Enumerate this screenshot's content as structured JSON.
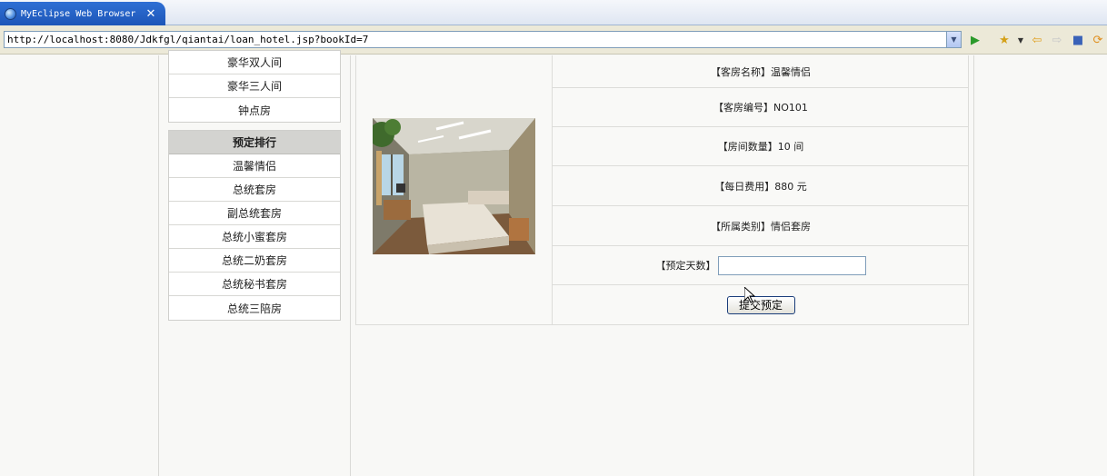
{
  "browser": {
    "tab_title": "MyEclipse Web Browser",
    "url": "http://localhost:8080/Jdkfgl/qiantai/loan_hotel.jsp?bookId=7"
  },
  "sidebar": {
    "room_types": [
      "豪华双人间",
      "豪华三人间",
      "钟点房"
    ],
    "ranking_title": "预定排行",
    "ranking_items": [
      "温馨情侣",
      "总统套房",
      "副总统套房",
      "总统小蜜套房",
      "总统二奶套房",
      "总统秘书套房",
      "总统三陪房"
    ]
  },
  "room": {
    "name_line": "【客房名称】温馨情侣",
    "code_line": "【客房编号】NO101",
    "count_line": "【房间数量】10 间",
    "fee_line": "【每日费用】880 元",
    "category_line": "【所属类别】情侣套房",
    "days_label": "【预定天数】",
    "days_value": "",
    "submit_label": "提交预定"
  },
  "colors": {
    "tab_blue": "#1d56b8",
    "sidebar_header": "#d3d3d0"
  }
}
